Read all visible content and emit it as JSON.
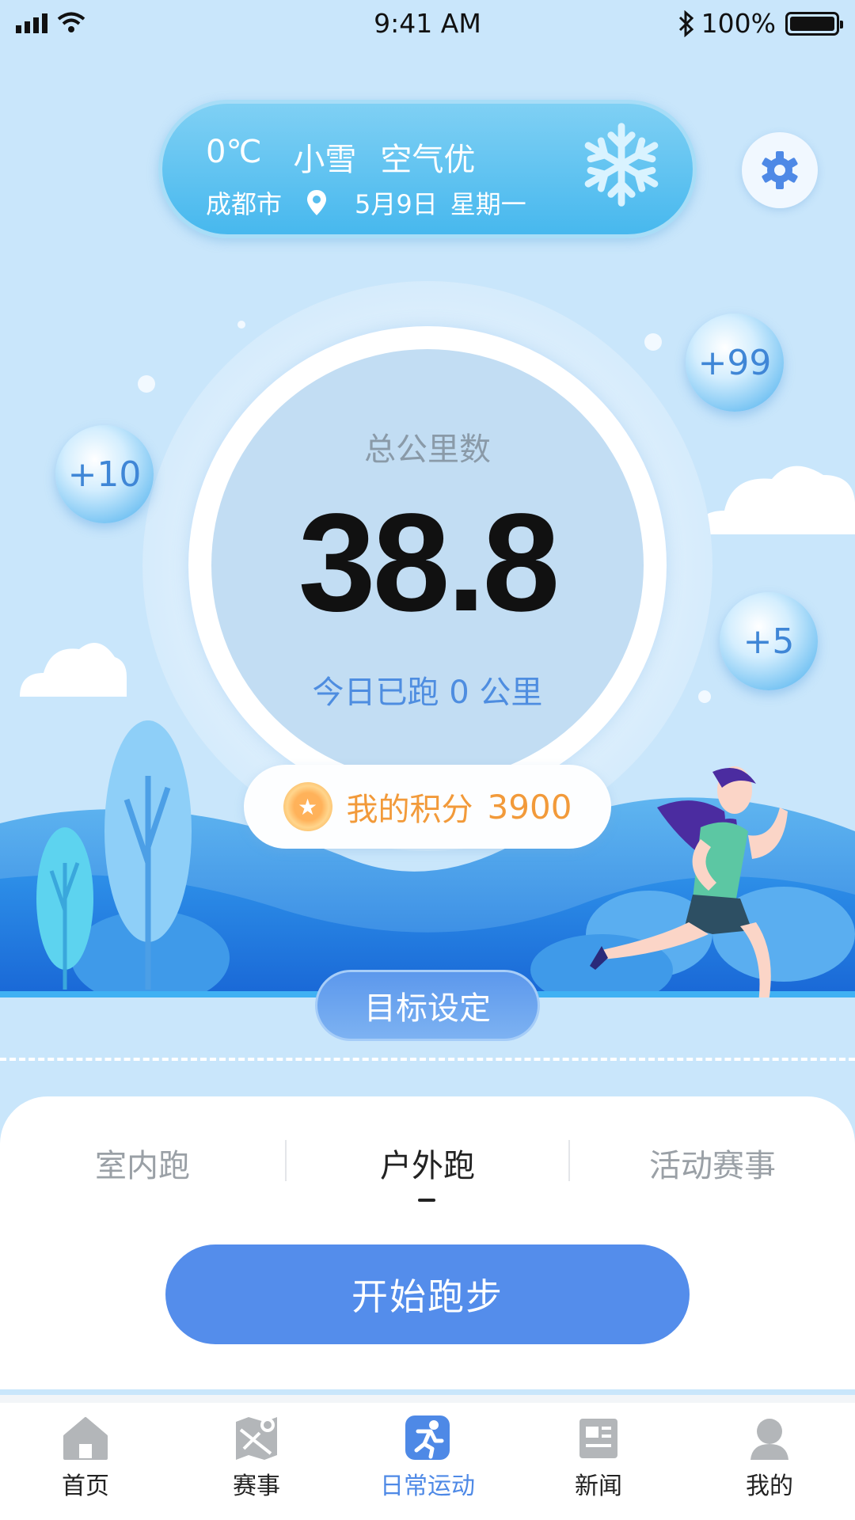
{
  "status_bar": {
    "time": "9:41 AM",
    "battery": "100%"
  },
  "weather": {
    "temperature": "0℃",
    "condition": "小雪",
    "air_quality": "空气优",
    "city": "成都市",
    "date": "5月9日",
    "weekday": "星期一",
    "icon": "snowflake-icon"
  },
  "stats": {
    "total_label": "总公里数",
    "total_value": "38.8",
    "today_text": "今日已跑 0 公里"
  },
  "bubbles": [
    "+99",
    "+10",
    "+5"
  ],
  "points": {
    "label": "我的积分",
    "value": "3900"
  },
  "goal_button": "目标设定",
  "tabs": [
    {
      "label": "室内跑",
      "active": false
    },
    {
      "label": "户外跑",
      "active": true
    },
    {
      "label": "活动赛事",
      "active": false
    }
  ],
  "start_button": "开始跑步",
  "nav": [
    {
      "label": "首页",
      "icon": "home-icon",
      "active": false
    },
    {
      "label": "赛事",
      "icon": "map-icon",
      "active": false
    },
    {
      "label": "日常运动",
      "icon": "runner-icon",
      "active": true
    },
    {
      "label": "新闻",
      "icon": "news-icon",
      "active": false
    },
    {
      "label": "我的",
      "icon": "user-icon",
      "active": false
    }
  ],
  "colors": {
    "accent": "#548deb",
    "points": "#f29a3a",
    "background": "#c9e6fb"
  }
}
